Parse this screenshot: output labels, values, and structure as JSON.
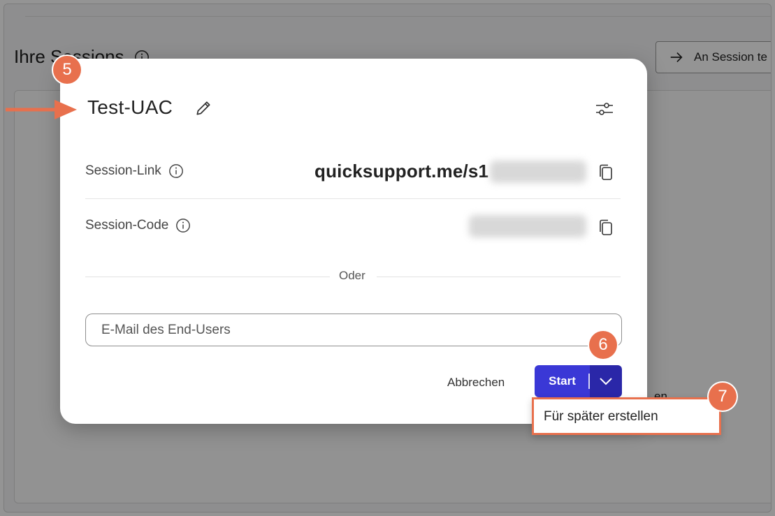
{
  "background": {
    "title": "Ihre Sessions",
    "join_button": "An Session te",
    "partial_text": "en"
  },
  "modal": {
    "title": "Test-UAC",
    "session_link_label": "Session-Link",
    "session_link_value": "quicksupport.me/s1",
    "session_code_label": "Session-Code",
    "or_text": "Oder",
    "email_placeholder": "E-Mail des End-Users",
    "cancel_label": "Abbrechen",
    "start_label": "Start",
    "dropdown_item": "Für später erstellen"
  },
  "annotations": {
    "step_5": "5",
    "step_6": "6",
    "step_7": "7"
  },
  "icons": [
    "info-icon",
    "arrow-right-icon",
    "pencil-icon",
    "sliders-icon",
    "copy-icon",
    "chevron-down-icon"
  ],
  "colors": {
    "accent": "#3a38d6",
    "accent_dark": "#2a27a8",
    "annotation": "#e8704d"
  }
}
